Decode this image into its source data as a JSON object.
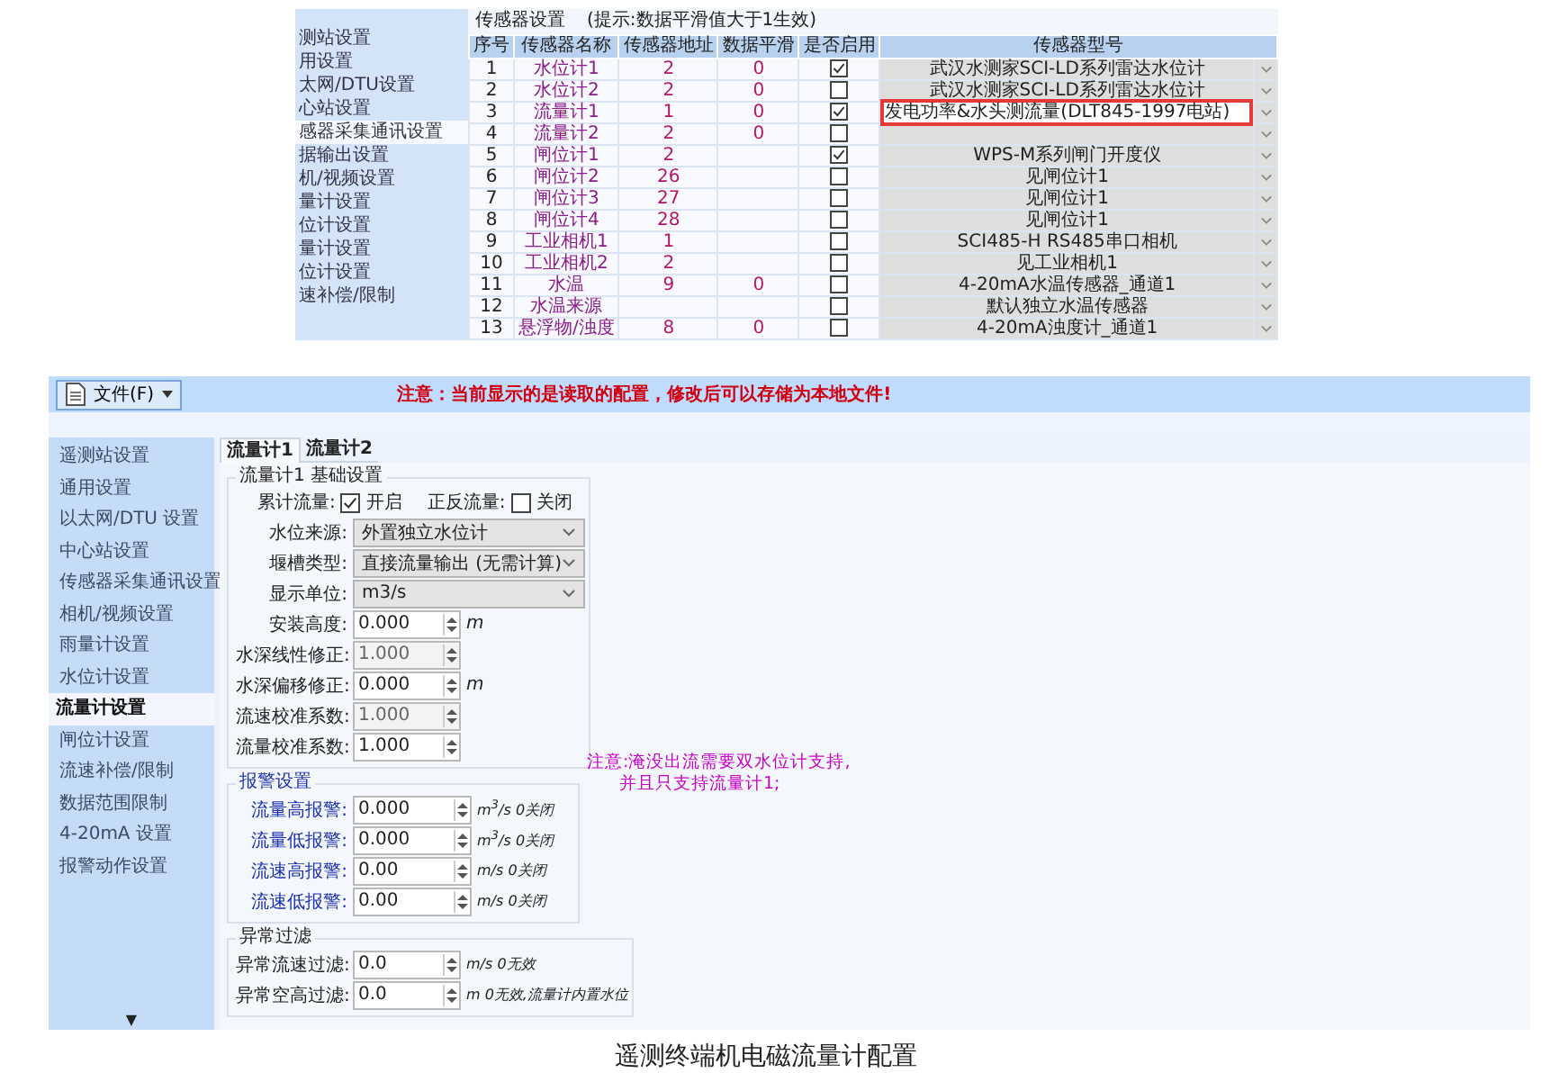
{
  "top_screenshot": {
    "sidebar": [
      {
        "label": "测站设置",
        "selected": false
      },
      {
        "label": "用设置",
        "selected": false
      },
      {
        "label": "太网/DTU设置",
        "selected": false
      },
      {
        "label": "心站设置",
        "selected": false
      },
      {
        "label": "感器采集通讯设置",
        "selected": true
      },
      {
        "label": "据输出设置",
        "selected": false
      },
      {
        "label": "机/视频设置",
        "selected": false
      },
      {
        "label": "量计设置",
        "selected": false
      },
      {
        "label": "位计设置",
        "selected": false
      },
      {
        "label": "量计设置",
        "selected": false
      },
      {
        "label": "位计设置",
        "selected": false
      },
      {
        "label": "速补偿/限制",
        "selected": false
      }
    ],
    "group_title": "传感器设置",
    "hint": "(提示:数据平滑值大于1生效)",
    "columns": [
      "序号",
      "传感器名称",
      "传感器地址",
      "数据平滑",
      "是否启用",
      "传感器型号"
    ],
    "rows": [
      {
        "no": "1",
        "name": "水位计1",
        "address": "2",
        "smoothing": "0",
        "enabled": true,
        "model": "武汉水测家SCI-LD系列雷达水位计"
      },
      {
        "no": "2",
        "name": "水位计2",
        "address": "2",
        "smoothing": "0",
        "enabled": false,
        "model": "武汉水测家SCI-LD系列雷达水位计"
      },
      {
        "no": "3",
        "name": "流量计1",
        "address": "1",
        "smoothing": "0",
        "enabled": true,
        "model": "发电功率&水头测流量(DLT845-1997电站)",
        "highlighted": true
      },
      {
        "no": "4",
        "name": "流量计2",
        "address": "2",
        "smoothing": "0",
        "enabled": false
      },
      {
        "no": "5",
        "name": "闸位计1",
        "address": "2",
        "enabled": true,
        "model": "WPS-M系列闸门开度仪"
      },
      {
        "no": "6",
        "name": "闸位计2",
        "address": "26",
        "enabled": false,
        "model": "见闸位计1"
      },
      {
        "no": "7",
        "name": "闸位计3",
        "address": "27",
        "enabled": false,
        "model": "见闸位计1"
      },
      {
        "no": "8",
        "name": "闸位计4",
        "address": "28",
        "enabled": false,
        "model": "见闸位计1"
      },
      {
        "no": "9",
        "name": "工业相机1",
        "address": "1",
        "enabled": false,
        "model": "SCI485-H RS485串口相机"
      },
      {
        "no": "10",
        "name": "工业相机2",
        "address": "2",
        "enabled": false,
        "model": "见工业相机1"
      },
      {
        "no": "11",
        "name": "水温",
        "address": "9",
        "smoothing": "0",
        "enabled": false,
        "model": "4-20mA水温传感器_通道1"
      },
      {
        "no": "12",
        "name": "水温来源",
        "enabled": false,
        "model": "默认独立水温传感器"
      },
      {
        "no": "13",
        "name": "悬浮物/浊度",
        "address": "8",
        "smoothing": "0",
        "enabled": false,
        "model": "4-20mA浊度计_通道1"
      }
    ]
  },
  "bottom_screenshot": {
    "toolbar": {
      "file_menu": "文件(F)",
      "warning": "注意：当前显示的是读取的配置，修改后可以存储为本地文件!"
    },
    "sidebar": [
      {
        "label": "遥测站设置",
        "selected": false
      },
      {
        "label": "通用设置",
        "selected": false
      },
      {
        "label": "以太网/DTU 设置",
        "selected": false
      },
      {
        "label": "中心站设置",
        "selected": false
      },
      {
        "label": "传感器采集通讯设置",
        "selected": false
      },
      {
        "label": "相机/视频设置",
        "selected": false
      },
      {
        "label": "雨量计设置",
        "selected": false
      },
      {
        "label": "水位计设置",
        "selected": false
      },
      {
        "label": "流量计设置",
        "selected": true
      },
      {
        "label": "闸位计设置",
        "selected": false
      },
      {
        "label": "流速补偿/限制",
        "selected": false
      },
      {
        "label": "数据范围限制",
        "selected": false
      },
      {
        "label": "4-20mA 设置",
        "selected": false
      },
      {
        "label": "报警动作设置",
        "selected": false
      }
    ],
    "scroll_arrow": "▼",
    "tabs": [
      {
        "label": "流量计1",
        "selected": true
      },
      {
        "label": "流量计2",
        "selected": false
      }
    ],
    "basic_group": {
      "title": "流量计1 基础设置",
      "toggles": [
        {
          "label": "累计流量:",
          "option": "开启",
          "checked": true
        },
        {
          "label": "正反流量:",
          "option": "关闭",
          "checked": false
        }
      ],
      "selects": [
        {
          "label": "水位来源:",
          "value": "外置独立水位计"
        },
        {
          "label": "堰槽类型:",
          "value": "直接流量输出 (无需计算)"
        },
        {
          "label": "显示单位:",
          "value": "m3/s"
        }
      ],
      "spins": [
        {
          "label": "安装高度:",
          "value": "0.000",
          "unit": "m",
          "disabled": false
        },
        {
          "label": "水深线性修正:",
          "value": "1.000",
          "disabled": true
        },
        {
          "label": "水深偏移修正:",
          "value": "0.000",
          "unit": "m",
          "disabled": false
        },
        {
          "label": "流速校准系数:",
          "value": "1.000",
          "disabled": true
        },
        {
          "label": "流量校准系数:",
          "value": "1.000",
          "disabled": false
        }
      ]
    },
    "alarm_group": {
      "title": "报警设置",
      "rows": [
        {
          "label": "流量高报警:",
          "value": "0.000",
          "unit": "m$^{3}$/s 0关闭"
        },
        {
          "label": "流量低报警:",
          "value": "0.000",
          "unit": "m$^{3}$/s 0关闭"
        },
        {
          "label": "流速高报警:",
          "value": "0.00",
          "unit": "m/s 0关闭"
        },
        {
          "label": "流速低报警:",
          "value": "0.00",
          "unit": "m/s 0关闭"
        }
      ]
    },
    "filter_group": {
      "title": "异常过滤",
      "rows": [
        {
          "label": "异常流速过滤:",
          "value": "0.0",
          "unit": "m/s 0无效"
        },
        {
          "label": "异常空高过滤:",
          "value": "0.0",
          "unit": "m 0无效,流量计内置水位"
        }
      ]
    },
    "note": [
      "注意:淹没出流需要双水位计支持,",
      "并且只支持流量计1;"
    ]
  },
  "caption": "遥测终端机电磁流量计配置"
}
